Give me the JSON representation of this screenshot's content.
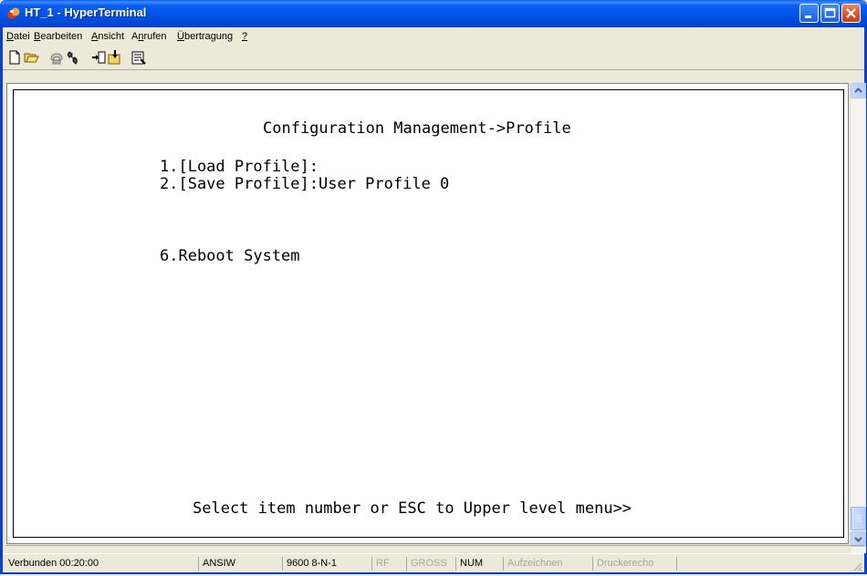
{
  "window": {
    "title": "HT_1 - HyperTerminal",
    "title_color": "#0a5ef5"
  },
  "menu": [
    {
      "label": "Datei",
      "accel": "D"
    },
    {
      "label": "Bearbeiten",
      "accel": "B"
    },
    {
      "label": "Ansicht",
      "accel": "A"
    },
    {
      "label": "Anrufen",
      "accel": "n"
    },
    {
      "label": "Übertragung",
      "accel": "Ü"
    },
    {
      "label": "?",
      "accel": "?"
    }
  ],
  "toolbar": {
    "icons": [
      "new-icon",
      "open-icon",
      "connect-icon",
      "disconnect-icon",
      "send-icon",
      "receive-icon",
      "properties-icon"
    ]
  },
  "terminal": {
    "header": "Configuration Management->Profile",
    "item1": "1.[Load Profile]:",
    "item2": "2.[Save Profile]:User Profile 0",
    "item6": "6.Reboot System",
    "prompt": "Select item number or ESC to Upper level menu>>"
  },
  "status": {
    "connected": "Verbunden 00:20:00",
    "emulation": "ANSIW",
    "port_settings": "9600 8-N-1",
    "scroll": "RF",
    "caps": "GROSS",
    "num": "NUM",
    "capture": "Aufzeichnen",
    "print_echo": "Druckerecho"
  }
}
